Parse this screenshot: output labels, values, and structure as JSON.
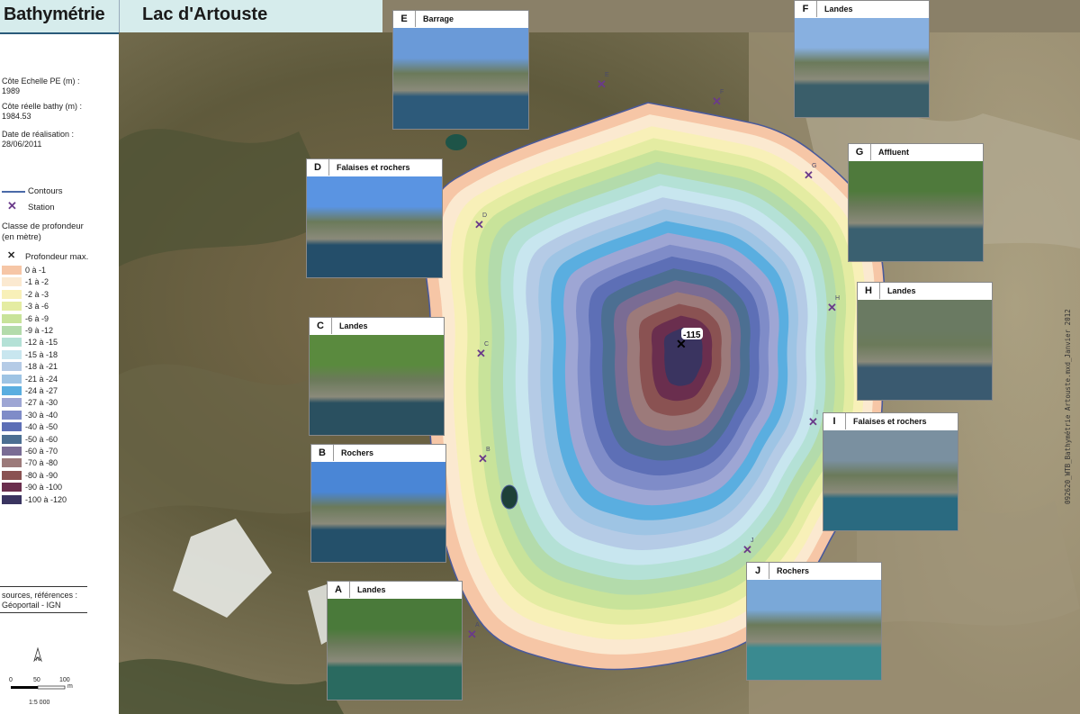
{
  "header": {
    "title_left": "Bathymétrie",
    "title_right": "Lac d'Artouste"
  },
  "info": {
    "cote_echelle_label": "Côte Echelle PE (m) :",
    "cote_echelle_value": "1989",
    "cote_reelle_label": "Côte réelle bathy (m) :",
    "cote_reelle_value": "1984.53",
    "date_label": "Date de réalisation :",
    "date_value": "28/06/2011"
  },
  "legend": {
    "contours": "Contours",
    "station": "Station",
    "classe_title_1": "Classe de profondeur",
    "classe_title_2": "(en mètre)",
    "prof_max": "Profondeur max.",
    "classes": [
      {
        "label": "0 à -1",
        "color": "#f6c6a6"
      },
      {
        "label": "-1 à -2",
        "color": "#fbe9d0"
      },
      {
        "label": "-2 à -3",
        "color": "#f8f0b8"
      },
      {
        "label": "-3 à -6",
        "color": "#e4eca2"
      },
      {
        "label": "-6 à -9",
        "color": "#c8e39a"
      },
      {
        "label": "-9 à -12",
        "color": "#b3dbab"
      },
      {
        "label": "-12 à -15",
        "color": "#b4e1d6"
      },
      {
        "label": "-15 à -18",
        "color": "#c8e6ef"
      },
      {
        "label": "-18 à -21",
        "color": "#b5cbe6"
      },
      {
        "label": "-21 à -24",
        "color": "#9ec4e4"
      },
      {
        "label": "-24 à -27",
        "color": "#5aaee0"
      },
      {
        "label": "-27 à -30",
        "color": "#9ea6d4"
      },
      {
        "label": "-30 à -40",
        "color": "#7f8cc8"
      },
      {
        "label": "-40 à -50",
        "color": "#5d6fb6"
      },
      {
        "label": "-50 à -60",
        "color": "#4c6f92"
      },
      {
        "label": "-60 à -70",
        "color": "#7a6c94"
      },
      {
        "label": "-70 à -80",
        "color": "#9c7a7a"
      },
      {
        "label": "-80 à -90",
        "color": "#8a5252"
      },
      {
        "label": "-90 à -100",
        "color": "#6a2e4e"
      },
      {
        "label": "-100 à -120",
        "color": "#3a3460"
      }
    ]
  },
  "sources": {
    "line1": "sources, références :",
    "line2": "Géoportail - IGN"
  },
  "scale": {
    "tick0": "0",
    "tick50": "50",
    "tick100": "100",
    "unit": "m",
    "ratio": "1:5 000",
    "north": "N"
  },
  "map": {
    "max_depth_label": "-115"
  },
  "stations": [
    {
      "label": "A"
    },
    {
      "label": "B"
    },
    {
      "label": "C"
    },
    {
      "label": "D"
    },
    {
      "label": "E"
    },
    {
      "label": "F"
    },
    {
      "label": "G"
    },
    {
      "label": "H"
    },
    {
      "label": "I"
    },
    {
      "label": "J"
    }
  ],
  "photos": [
    {
      "letter": "E",
      "title": "Barrage"
    },
    {
      "letter": "F",
      "title": "Landes"
    },
    {
      "letter": "D",
      "title": "Falaises et rochers"
    },
    {
      "letter": "G",
      "title": "Affluent"
    },
    {
      "letter": "C",
      "title": "Landes"
    },
    {
      "letter": "H",
      "title": "Landes"
    },
    {
      "letter": "B",
      "title": "Rochers"
    },
    {
      "letter": "I",
      "title": "Falaises et rochers"
    },
    {
      "letter": "J",
      "title": "Rochers"
    },
    {
      "letter": "A",
      "title": "Landes"
    }
  ],
  "credit": "092620_WTB_Bathymétrie Artouste.mxd_Janvier 2012"
}
